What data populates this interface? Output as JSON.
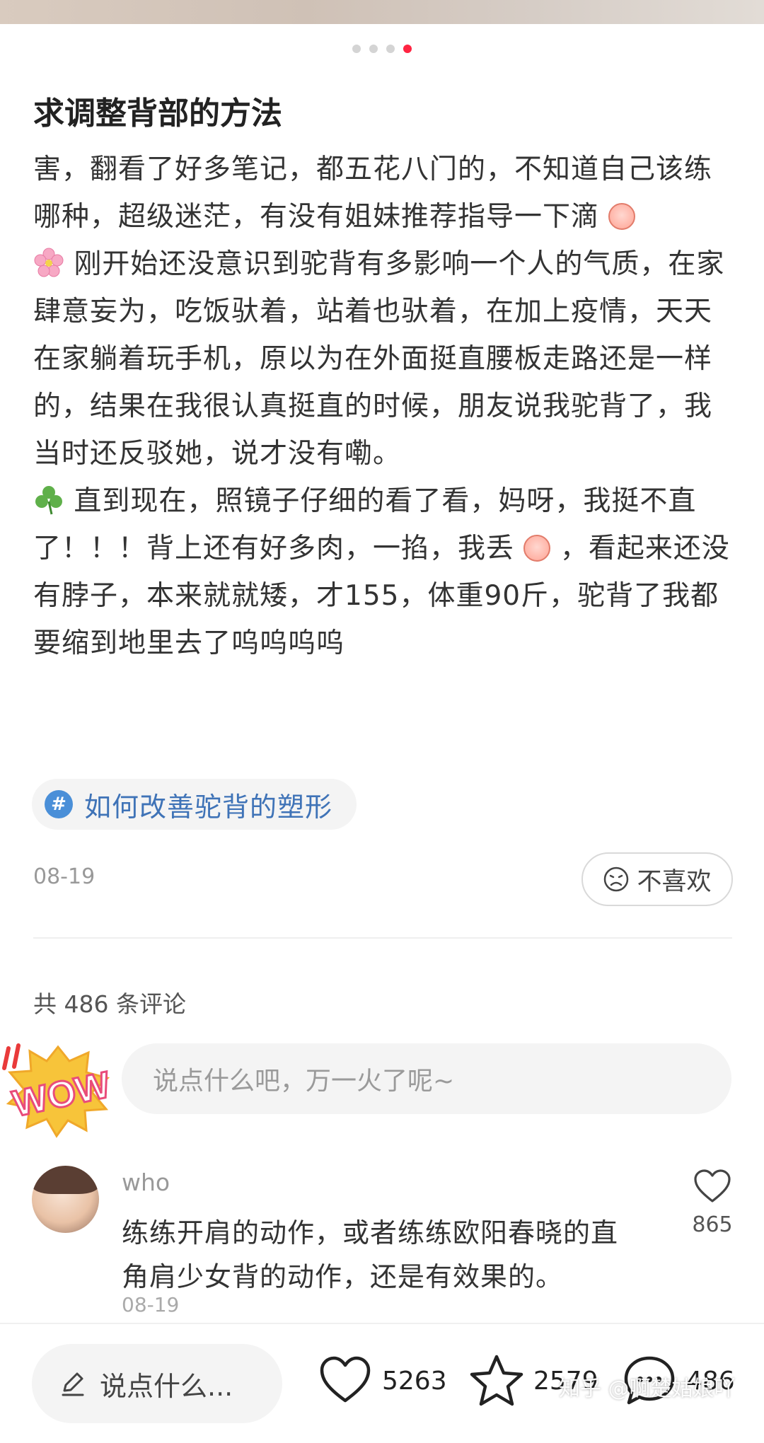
{
  "carousel": {
    "active_index": 4,
    "count": 4
  },
  "post": {
    "title": "求调整背部的方法",
    "paragraph1_a": "害，翻看了好多笔记，都五花八门的，不知道自己该练哪种，超级迷茫，有没有姐妹推荐指导一下滴",
    "paragraph2": "刚开始还没意识到驼背有多影响一个人的气质，在家肆意妄为，吃饭驮着，站着也驮着，在加上疫情，天天在家躺着玩手机，原以为在外面挺直腰板走路还是一样的，结果在我很认真挺直的时候，朋友说我驼背了，我当时还反驳她，说才没有嘞。",
    "paragraph3_a": "直到现在，照镜子仔细的看了看，妈呀，我挺不直了！！！背上还有好多肉，一掐，我丢",
    "paragraph3_b": "，看起来还没有脖子，本来就就矮，才155，体重90斤，驼背了我都要缩到地里去了呜呜呜呜",
    "tag": "如何改善驼背的塑形",
    "date": "08-19",
    "dislike_label": "不喜欢"
  },
  "comments": {
    "count_label": "共 486 条评论",
    "input_placeholder": "说点什么吧，万一火了呢~",
    "items": [
      {
        "user": "who",
        "text": "练练开肩的动作，或者练练欧阳春晓的直角肩少女背的动作，还是有效果的。",
        "date": "08-19",
        "likes": "865"
      }
    ]
  },
  "bottom_bar": {
    "say_label": "说点什么...",
    "likes": "5263",
    "collects": "2579",
    "comments": "486"
  },
  "watermark": "知乎 @啊楚姑娘吖",
  "colors": {
    "accent": "#ff2442",
    "tag": "#3f73b7"
  }
}
